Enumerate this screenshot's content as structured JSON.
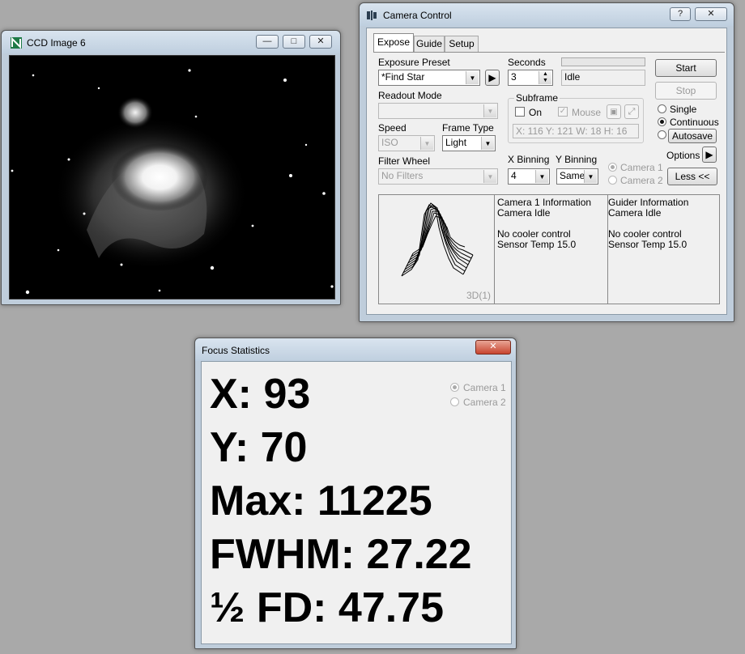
{
  "ccd_window": {
    "title": "CCD Image 6"
  },
  "camera_control": {
    "title": "Camera Control",
    "help_button": "?",
    "tabs": [
      {
        "label": "Expose"
      },
      {
        "label": "Guide"
      },
      {
        "label": "Setup"
      }
    ],
    "exposure_preset_label": "Exposure Preset",
    "exposure_preset_value": "*Find Star",
    "seconds_label": "Seconds",
    "seconds_value": "3",
    "status_value": "Idle",
    "start_label": "Start",
    "stop_label": "Stop",
    "readout_mode_label": "Readout Mode",
    "subframe_label": "Subframe",
    "subframe_on_label": "On",
    "subframe_mouse_label": "Mouse",
    "subframe_coords": "X: 116 Y: 121 W:  18 H:  16",
    "speed_label": "Speed",
    "speed_value": "ISO",
    "frame_type_label": "Frame Type",
    "frame_type_value": "Light",
    "mode_single": "Single",
    "mode_continuous": "Continuous",
    "autosave_label": "Autosave",
    "options_label": "Options",
    "filter_wheel_label": "Filter Wheel",
    "filter_wheel_value": "No Filters",
    "x_binning_label": "X Binning",
    "x_binning_value": "4",
    "y_binning_label": "Y Binning",
    "y_binning_value": "Same",
    "camera1_label": "Camera 1",
    "camera2_label": "Camera 2",
    "less_label": "Less <<",
    "plot_label": "3D(1)",
    "camera1_info": {
      "heading": "Camera 1 Information",
      "status": "Camera Idle",
      "cooler": "No cooler control",
      "temp": "Sensor Temp 15.0"
    },
    "guider_info": {
      "heading": "Guider Information",
      "status": "Camera Idle",
      "cooler": "No cooler control",
      "temp": "Sensor Temp 15.0"
    }
  },
  "focus_statistics": {
    "title": "Focus Statistics",
    "x": "X: 93",
    "y": "Y: 70",
    "max": "Max: 11225",
    "fwhm": "FWHM: 27.22",
    "half_fd": "½ FD: 47.75",
    "camera1_label": "Camera 1",
    "camera2_label": "Camera 2"
  }
}
